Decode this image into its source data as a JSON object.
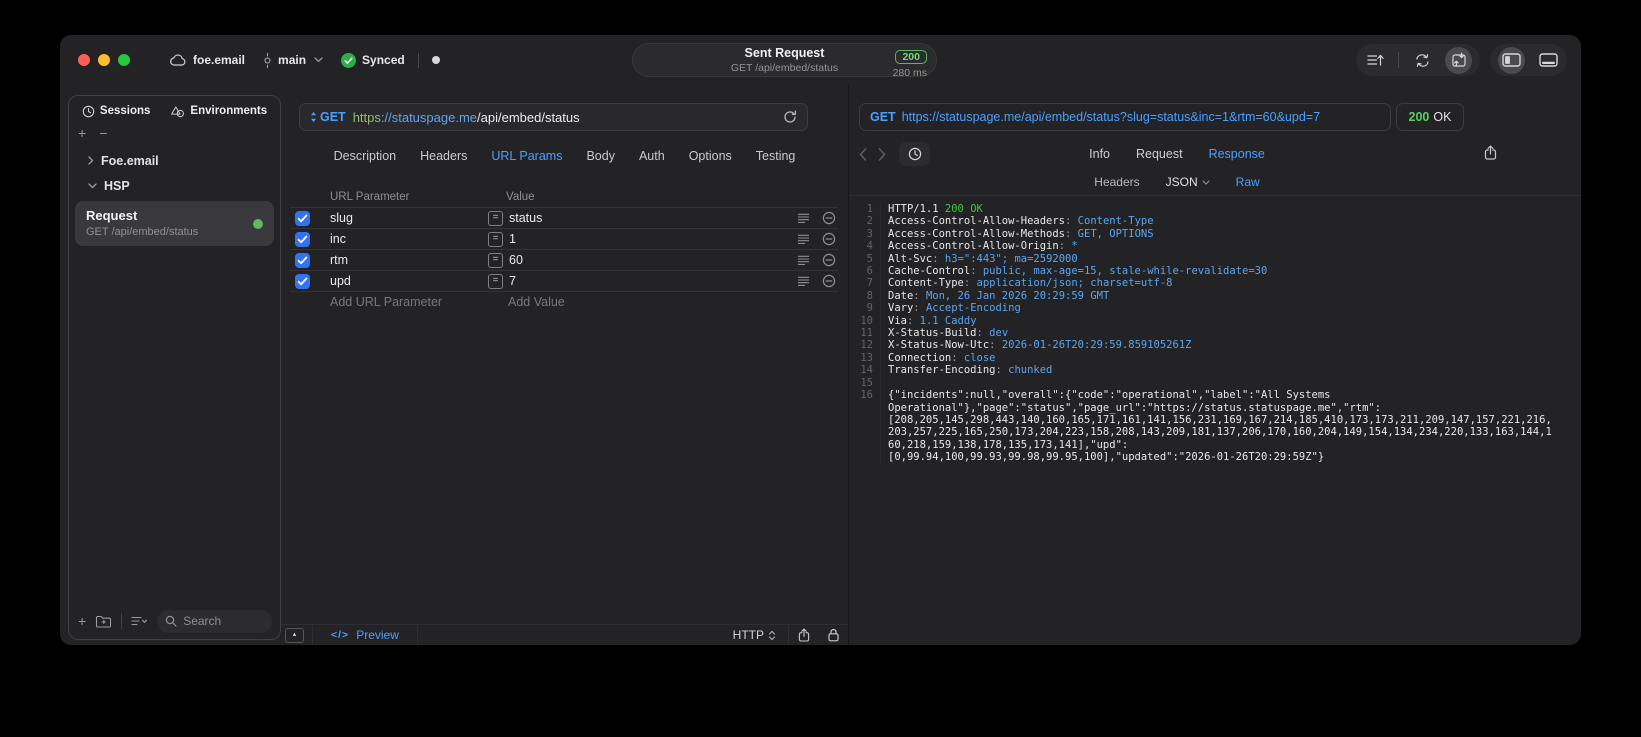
{
  "titlebar": {
    "project": "foe.email",
    "branch": "main",
    "sync_status": "Synced",
    "request_pill": {
      "title": "Sent Request",
      "subtitle": "GET /api/embed/status",
      "status_code": "200",
      "duration": "280 ms"
    }
  },
  "sidebar": {
    "tabs": [
      {
        "label": "Sessions",
        "icon": "clock-icon"
      },
      {
        "label": "Environments",
        "icon": "environments-icon"
      }
    ],
    "tree": [
      {
        "label": "Foe.email",
        "state": "collapsed"
      },
      {
        "label": "HSP",
        "state": "expanded"
      }
    ],
    "request_item": {
      "title": "Request",
      "subtitle": "GET /api/embed/status",
      "status_dot_color": "#63b663"
    },
    "search_placeholder": "Search"
  },
  "request_panel": {
    "method": "GET",
    "url": {
      "scheme": "https",
      "host": "://statuspage.me",
      "path": "/api/embed/status"
    },
    "tabs": [
      "Description",
      "Headers",
      "URL Params",
      "Body",
      "Auth",
      "Options",
      "Testing"
    ],
    "active_tab": "URL Params",
    "params_table": {
      "columns": [
        "URL Parameter",
        "Value"
      ],
      "rows": [
        {
          "name": "slug",
          "value": "status",
          "enabled": true
        },
        {
          "name": "inc",
          "value": "1",
          "enabled": true
        },
        {
          "name": "rtm",
          "value": "60",
          "enabled": true
        },
        {
          "name": "upd",
          "value": "7",
          "enabled": true
        }
      ],
      "add_row": {
        "name_placeholder": "Add URL Parameter",
        "value_placeholder": "Add Value"
      }
    },
    "footer": {
      "code_glyph": "</>",
      "preview_label": "Preview",
      "protocol": "HTTP"
    }
  },
  "response_panel": {
    "method": "GET",
    "url": "https://statuspage.me/api/embed/status?slug=status&inc=1&rtm=60&upd=7",
    "status_code": "200",
    "status_text": "OK",
    "tabs": [
      "Info",
      "Request",
      "Response"
    ],
    "active_tab": "Response",
    "subtabs": [
      "Headers",
      "JSON",
      "Raw"
    ],
    "active_subtab": "Raw",
    "body_lines": [
      {
        "n": "1",
        "parts": [
          [
            "HTTP/1.1 ",
            "w"
          ],
          [
            "200 OK",
            "g"
          ]
        ]
      },
      {
        "n": "2",
        "parts": [
          [
            "Access-Control-Allow-Headers",
            "w"
          ],
          [
            ": ",
            "d"
          ],
          [
            "Content-Type",
            "b"
          ]
        ]
      },
      {
        "n": "3",
        "parts": [
          [
            "Access-Control-Allow-Methods",
            "w"
          ],
          [
            ": ",
            "d"
          ],
          [
            "GET, OPTIONS",
            "b"
          ]
        ]
      },
      {
        "n": "4",
        "parts": [
          [
            "Access-Control-Allow-Origin",
            "w"
          ],
          [
            ": ",
            "d"
          ],
          [
            "*",
            "b"
          ]
        ]
      },
      {
        "n": "5",
        "parts": [
          [
            "Alt-Svc",
            "w"
          ],
          [
            ": ",
            "d"
          ],
          [
            "h3=\":443\"; ma=2592000",
            "b"
          ]
        ]
      },
      {
        "n": "6",
        "parts": [
          [
            "Cache-Control",
            "w"
          ],
          [
            ": ",
            "d"
          ],
          [
            "public, max-age=15, stale-while-revalidate=30",
            "b"
          ]
        ]
      },
      {
        "n": "7",
        "parts": [
          [
            "Content-Type",
            "w"
          ],
          [
            ": ",
            "d"
          ],
          [
            "application/json; charset=utf-8",
            "b"
          ]
        ]
      },
      {
        "n": "8",
        "parts": [
          [
            "Date",
            "w"
          ],
          [
            ": ",
            "d"
          ],
          [
            "Mon, 26 Jan 2026 20:29:59 GMT",
            "b"
          ]
        ]
      },
      {
        "n": "9",
        "parts": [
          [
            "Vary",
            "w"
          ],
          [
            ": ",
            "d"
          ],
          [
            "Accept-Encoding",
            "b"
          ]
        ]
      },
      {
        "n": "10",
        "parts": [
          [
            "Via",
            "w"
          ],
          [
            ": ",
            "d"
          ],
          [
            "1.1 Caddy",
            "b"
          ]
        ]
      },
      {
        "n": "11",
        "parts": [
          [
            "X-Status-Build",
            "w"
          ],
          [
            ": ",
            "d"
          ],
          [
            "dev",
            "b"
          ]
        ]
      },
      {
        "n": "12",
        "parts": [
          [
            "X-Status-Now-Utc",
            "w"
          ],
          [
            ": ",
            "d"
          ],
          [
            "2026-01-26T20:29:59.859105261Z",
            "b"
          ]
        ]
      },
      {
        "n": "13",
        "parts": [
          [
            "Connection",
            "w"
          ],
          [
            ": ",
            "d"
          ],
          [
            "close",
            "b"
          ]
        ]
      },
      {
        "n": "14",
        "parts": [
          [
            "Transfer-Encoding",
            "w"
          ],
          [
            ": ",
            "d"
          ],
          [
            "chunked",
            "b"
          ]
        ]
      },
      {
        "n": "15",
        "parts": []
      },
      {
        "n": "16",
        "parts": [
          [
            "{\"incidents\":null,\"overall\":{\"code\":\"operational\",\"label\":\"All Systems",
            "w"
          ]
        ]
      },
      {
        "n": "",
        "parts": [
          [
            "Operational\"},\"page\":\"status\",\"page_url\":\"https://status.statuspage.me\",\"rtm\":",
            "w"
          ]
        ]
      },
      {
        "n": "",
        "parts": [
          [
            "[208,205,145,298,443,140,160,165,171,161,141,156,231,169,167,214,185,410,173,173,211,209,147,157,221,216,",
            "w"
          ]
        ]
      },
      {
        "n": "",
        "parts": [
          [
            "203,257,225,165,250,173,204,223,158,208,143,209,181,137,206,170,160,204,149,154,134,234,220,133,163,144,1",
            "w"
          ]
        ]
      },
      {
        "n": "",
        "parts": [
          [
            "60,218,159,138,178,135,173,141],\"upd\":",
            "w"
          ]
        ]
      },
      {
        "n": "",
        "parts": [
          [
            "[0,99.94,100,99.93,99.98,99.95,100],\"updated\":\"2026-01-26T20:29:59Z\"}",
            "w"
          ]
        ]
      }
    ]
  },
  "colors": {
    "accent_blue": "#4b9fff",
    "checkbox_blue": "#3273f5",
    "badge_green": "#6fd67d",
    "status_green": "#3fc53f",
    "scheme_green": "#8fbe6c",
    "sync_green": "#2fae47"
  }
}
